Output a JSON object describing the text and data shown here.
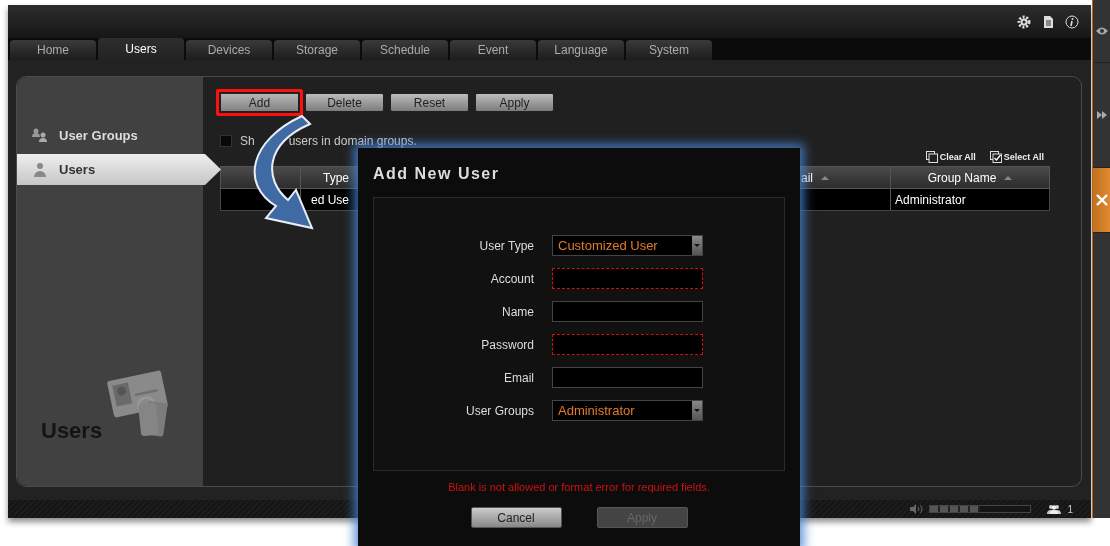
{
  "tabs": [
    {
      "label": "Home",
      "selected": false
    },
    {
      "label": "Users",
      "selected": true
    },
    {
      "label": "Devices",
      "selected": false
    },
    {
      "label": "Storage",
      "selected": false
    },
    {
      "label": "Schedule",
      "selected": false
    },
    {
      "label": "Event",
      "selected": false
    },
    {
      "label": "Language",
      "selected": false
    },
    {
      "label": "System",
      "selected": false
    }
  ],
  "sidebar": {
    "items": [
      {
        "label": "User Groups",
        "kind": "group",
        "selected": false
      },
      {
        "label": "Users",
        "kind": "user",
        "selected": true
      }
    ],
    "caption": "Users"
  },
  "toolbar": {
    "buttons": [
      {
        "label": "Add",
        "highlighted": true
      },
      {
        "label": "Delete",
        "highlighted": false
      },
      {
        "label": "Reset",
        "highlighted": false
      },
      {
        "label": "Apply",
        "highlighted": false
      }
    ]
  },
  "domain_filter": {
    "label_parts": [
      "Sh",
      "users in domain groups."
    ],
    "checked": false
  },
  "selection_links": [
    {
      "label": "Clear All",
      "kind": "clear"
    },
    {
      "label": "Select All",
      "kind": "select"
    }
  ],
  "table": {
    "columns": [
      {
        "label": "Type"
      },
      {
        "label": "ail",
        "sortable": true
      },
      {
        "label": "Group Name",
        "sortable": true
      }
    ],
    "rows": [
      {
        "cells": [
          "ed Use",
          "Administrator"
        ],
        "selected": false
      }
    ]
  },
  "dialog": {
    "title": "Add New User",
    "fields": [
      {
        "label": "User Type",
        "kind": "select",
        "value": "Customized User",
        "invalid": false
      },
      {
        "label": "Account",
        "kind": "text",
        "invalid": true
      },
      {
        "label": "Name",
        "kind": "text",
        "invalid": false
      },
      {
        "label": "Password",
        "kind": "password",
        "invalid": true
      },
      {
        "label": "Email",
        "kind": "text",
        "invalid": false
      },
      {
        "label": "User Groups",
        "kind": "select",
        "value": "Administrator",
        "invalid": false
      }
    ],
    "error": "Blank is not allowed or format error for required fields.",
    "buttons": [
      {
        "label": "Cancel",
        "disabled": false
      },
      {
        "label": "Apply",
        "disabled": true
      }
    ]
  },
  "status_bar": {
    "volume": {
      "level": 0.5
    },
    "online_users": "1"
  }
}
